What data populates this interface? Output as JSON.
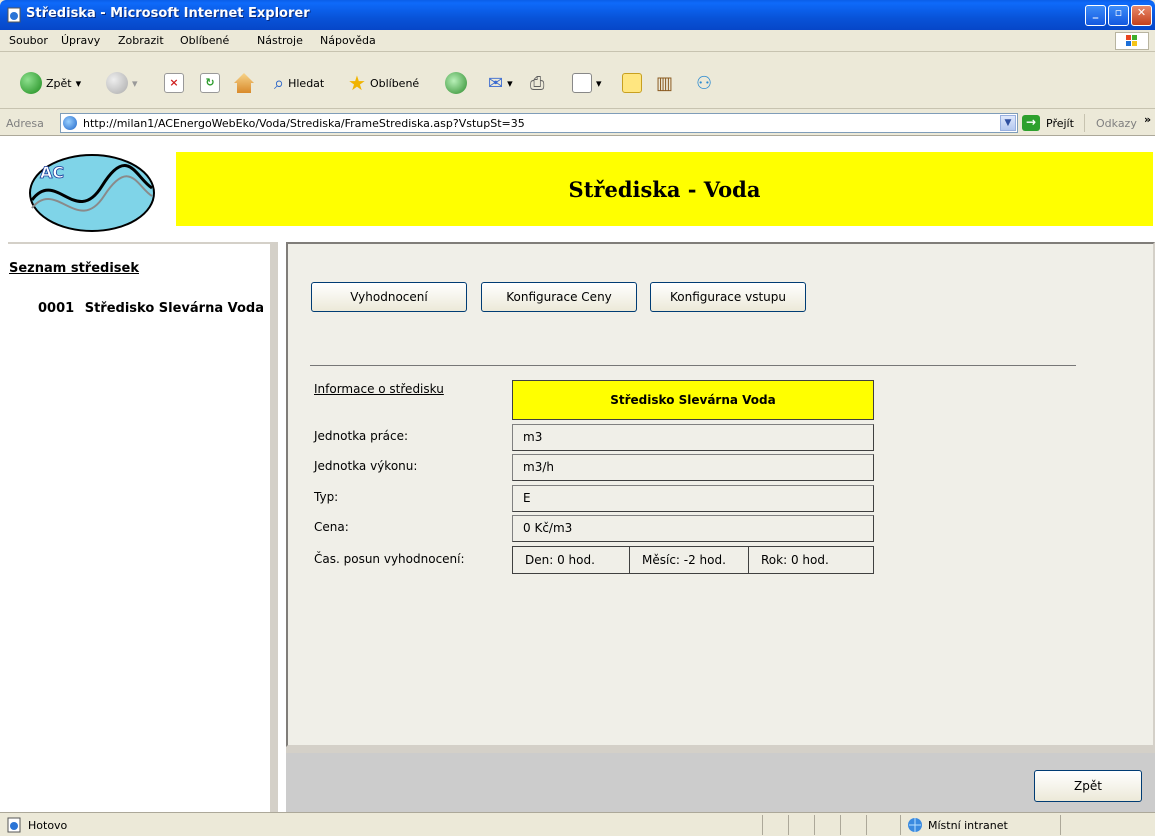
{
  "window": {
    "title": "Střediska - Microsoft Internet Explorer",
    "icon": "ie-page-icon",
    "controls": [
      "minimize",
      "maximize",
      "close"
    ]
  },
  "menu": {
    "items": [
      "Soubor",
      "Úpravy",
      "Zobrazit",
      "Oblíbené",
      "Nástroje",
      "Nápověda"
    ]
  },
  "toolbar": {
    "back_label": "Zpět",
    "search_label": "Hledat",
    "favorites_label": "Oblíbené"
  },
  "address": {
    "label": "Adresa",
    "url": "http://milan1/ACEnergoWebEko/Voda/Strediska/FrameStrediska.asp?VstupSt=35",
    "go_label": "Přejít",
    "links_label": "Odkazy"
  },
  "header": {
    "logo_text": "AC",
    "banner_title": "Střediska - Voda",
    "banner_color": "#ffff00"
  },
  "sidebar": {
    "heading": "Seznam středisek",
    "items": [
      {
        "code": "0001",
        "name": "Středisko Slevárna Voda"
      }
    ]
  },
  "main": {
    "buttons": {
      "evaluate": "Vyhodnocení",
      "price_config": "Konfigurace Ceny",
      "input_config": "Konfigurace vstupu"
    },
    "info_title": "Informace o středisku",
    "center_name": "Středisko Slevárna Voda",
    "fields": {
      "work_unit_label": "Jednotka práce:",
      "work_unit_value": "m3",
      "power_unit_label": "Jednotka výkonu:",
      "power_unit_value": "m3/h",
      "type_label": "Typ:",
      "type_value": "E",
      "price_label": "Cena:",
      "price_value": "0 Kč/m3",
      "shift_label": "Čas. posun vyhodnocení:",
      "shift_day": "Den: 0 hod.",
      "shift_month": "Měsíc: -2 hod.",
      "shift_year": "Rok: 0 hod."
    }
  },
  "footer": {
    "back_button": "Zpět"
  },
  "status": {
    "text": "Hotovo",
    "zone": "Místní intranet"
  }
}
